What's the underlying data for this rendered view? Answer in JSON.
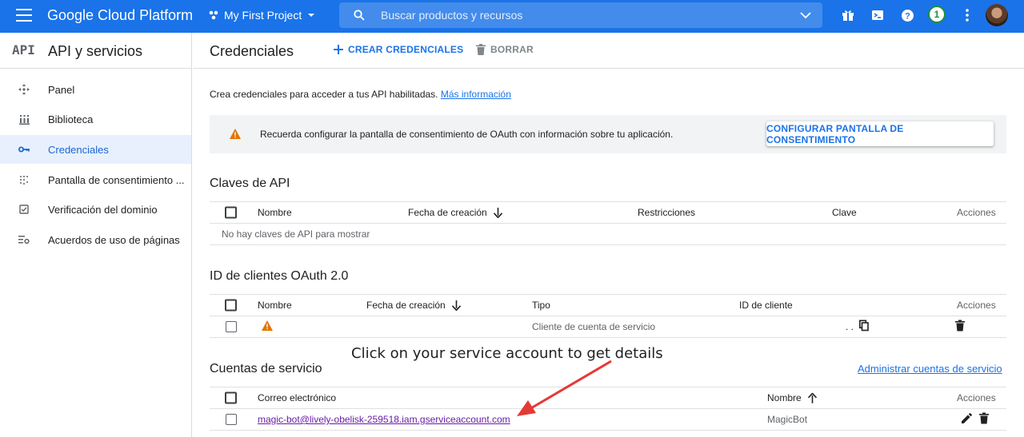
{
  "topbar": {
    "brand": "Google Cloud Platform",
    "project": "My First Project",
    "search_placeholder": "Buscar productos y recursos",
    "notifications_count": "1"
  },
  "sidebar": {
    "logo": "API",
    "title": "API y servicios",
    "items": [
      {
        "label": "Panel",
        "icon": "dashboard-icon"
      },
      {
        "label": "Biblioteca",
        "icon": "library-icon"
      },
      {
        "label": "Credenciales",
        "icon": "key-icon",
        "active": true
      },
      {
        "label": "Pantalla de consentimiento ...",
        "icon": "consent-icon"
      },
      {
        "label": "Verificación del dominio",
        "icon": "checkbox-icon"
      },
      {
        "label": "Acuerdos de uso de páginas",
        "icon": "settings-list-icon"
      }
    ]
  },
  "header": {
    "title": "Credenciales",
    "create_label": "CREAR CREDENCIALES",
    "delete_label": "BORRAR"
  },
  "intro": {
    "text": "Crea credenciales para acceder a tus API habilitadas. ",
    "link": "Más información"
  },
  "banner": {
    "text": "Recuerda configurar la pantalla de consentimiento de OAuth con información sobre tu aplicación.",
    "button": "CONFIGURAR PANTALLA DE CONSENTIMIENTO"
  },
  "api_keys": {
    "title": "Claves de API",
    "columns": [
      "Nombre",
      "Fecha de creación",
      "Restricciones",
      "Clave",
      "Acciones"
    ],
    "empty": "No hay claves de API para mostrar"
  },
  "oauth": {
    "title": "ID de clientes OAuth 2.0",
    "columns": [
      "Nombre",
      "Fecha de creación",
      "Tipo",
      "ID de cliente",
      "Acciones"
    ],
    "rows": [
      {
        "type": "Cliente de cuenta de servicio",
        "client_id": ". ."
      }
    ]
  },
  "service_accounts": {
    "title": "Cuentas de servicio",
    "manage_link": "Administrar cuentas de servicio",
    "columns": [
      "Correo electrónico",
      "Nombre",
      "Acciones"
    ],
    "rows": [
      {
        "email": "magic-bot@lively-obelisk-259518.iam.gserviceaccount.com",
        "name": "MagicBot"
      }
    ]
  },
  "annotation": "Click on your service account to get details",
  "colors": {
    "topbar": "#1a73e8",
    "accent": "#1a73e8",
    "warning": "#e37400",
    "arrow": "#e53935",
    "visited_link": "#681da8"
  }
}
